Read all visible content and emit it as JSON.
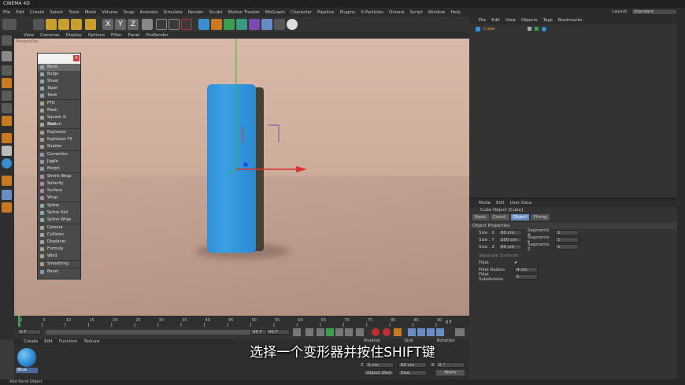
{
  "app": {
    "title": "CINEMA 4D",
    "layout_label": "Layout:",
    "layout_value": "Standard"
  },
  "menubar": [
    "File",
    "Edit",
    "Create",
    "Select",
    "Tools",
    "Mesh",
    "Volume",
    "Snap",
    "Animate",
    "Simulate",
    "Render",
    "Sculpt",
    "Motion Tracker",
    "MoGraph",
    "Character",
    "Pipeline",
    "Plugins",
    "X-Particles",
    "Octane",
    "Script",
    "Window",
    "Help"
  ],
  "viewport": {
    "menu": [
      "View",
      "Cameras",
      "Display",
      "Options",
      "Filter",
      "Panel",
      "ProRender"
    ],
    "label": "Perspective"
  },
  "deformer_menu": {
    "items": [
      [
        "Bend",
        "Bulge",
        "Shear",
        "Taper",
        "Twist"
      ],
      [
        "FFD",
        "Mesh",
        "Squash & Stretch",
        "Melt"
      ],
      [
        "Explosion",
        "Explosion FX",
        "Shatter"
      ],
      [
        "Correction",
        "Jiggle",
        "Morph"
      ],
      [
        "Shrink Wrap",
        "Spherify",
        "Surface",
        "Wrap"
      ],
      [
        "Spline",
        "Spline Rail",
        "Spline Wrap"
      ],
      [
        "Camera",
        "Collision",
        "Displacer",
        "Formula",
        "Wind"
      ],
      [
        "Smoothing"
      ],
      [
        "Bevel"
      ]
    ]
  },
  "timeline": {
    "ticks": [
      "0",
      "5",
      "10",
      "15",
      "20",
      "25",
      "30",
      "35",
      "40",
      "45",
      "50",
      "55",
      "60",
      "65",
      "70",
      "75",
      "80",
      "85",
      "90"
    ],
    "current": "0 F",
    "start": "0 F",
    "end": "90 F",
    "end2": "90 F"
  },
  "material_manager": {
    "menu": [
      "Create",
      "Edit",
      "Function",
      "Texture"
    ],
    "material_name": "Blue"
  },
  "coords": {
    "headers": [
      "Position",
      "Size",
      "Rotation"
    ],
    "z_row": {
      "label": "Z",
      "pos": "0 cm",
      "size": "60 cm",
      "rot": "B",
      "rot_val": "0 °"
    },
    "mode": "Object (Rel)",
    "size_mode": "Size",
    "apply": "Apply"
  },
  "object_manager": {
    "menu": [
      "File",
      "Edit",
      "View",
      "Objects",
      "Tags",
      "Bookmarks"
    ],
    "object_name": "Cube"
  },
  "attributes": {
    "menu": [
      "Mode",
      "Edit",
      "User Data"
    ],
    "title": "Cube Object [Cube]",
    "tabs": [
      "Basic",
      "Coord.",
      "Object",
      "Phong"
    ],
    "section": "Object Properties",
    "size_rows": [
      {
        "axis": "Size . X",
        "value": "60 cm",
        "seg_label": "Segments X",
        "seg": "1"
      },
      {
        "axis": "Size . Y",
        "value": "200 cm",
        "seg_label": "Segments Y",
        "seg": "1"
      },
      {
        "axis": "Size . Z",
        "value": "60 cm",
        "seg_label": "Segments Z",
        "seg": "1"
      }
    ],
    "separate_surfaces": "Separate Surfaces",
    "fillet": "Fillet",
    "fillet_radius_label": "Fillet Radius",
    "fillet_radius": "4 cm",
    "fillet_sub_label": "Fillet Subdivision",
    "fillet_sub": "5"
  },
  "status": "Add Bend Object",
  "subtitle": "选择一个变形器并按住SHIFT键",
  "colors": {
    "accent_blue": "#2f8fd8",
    "x_axis": "#e03030",
    "y_axis": "#30c030",
    "z_axis": "#2050e0"
  }
}
